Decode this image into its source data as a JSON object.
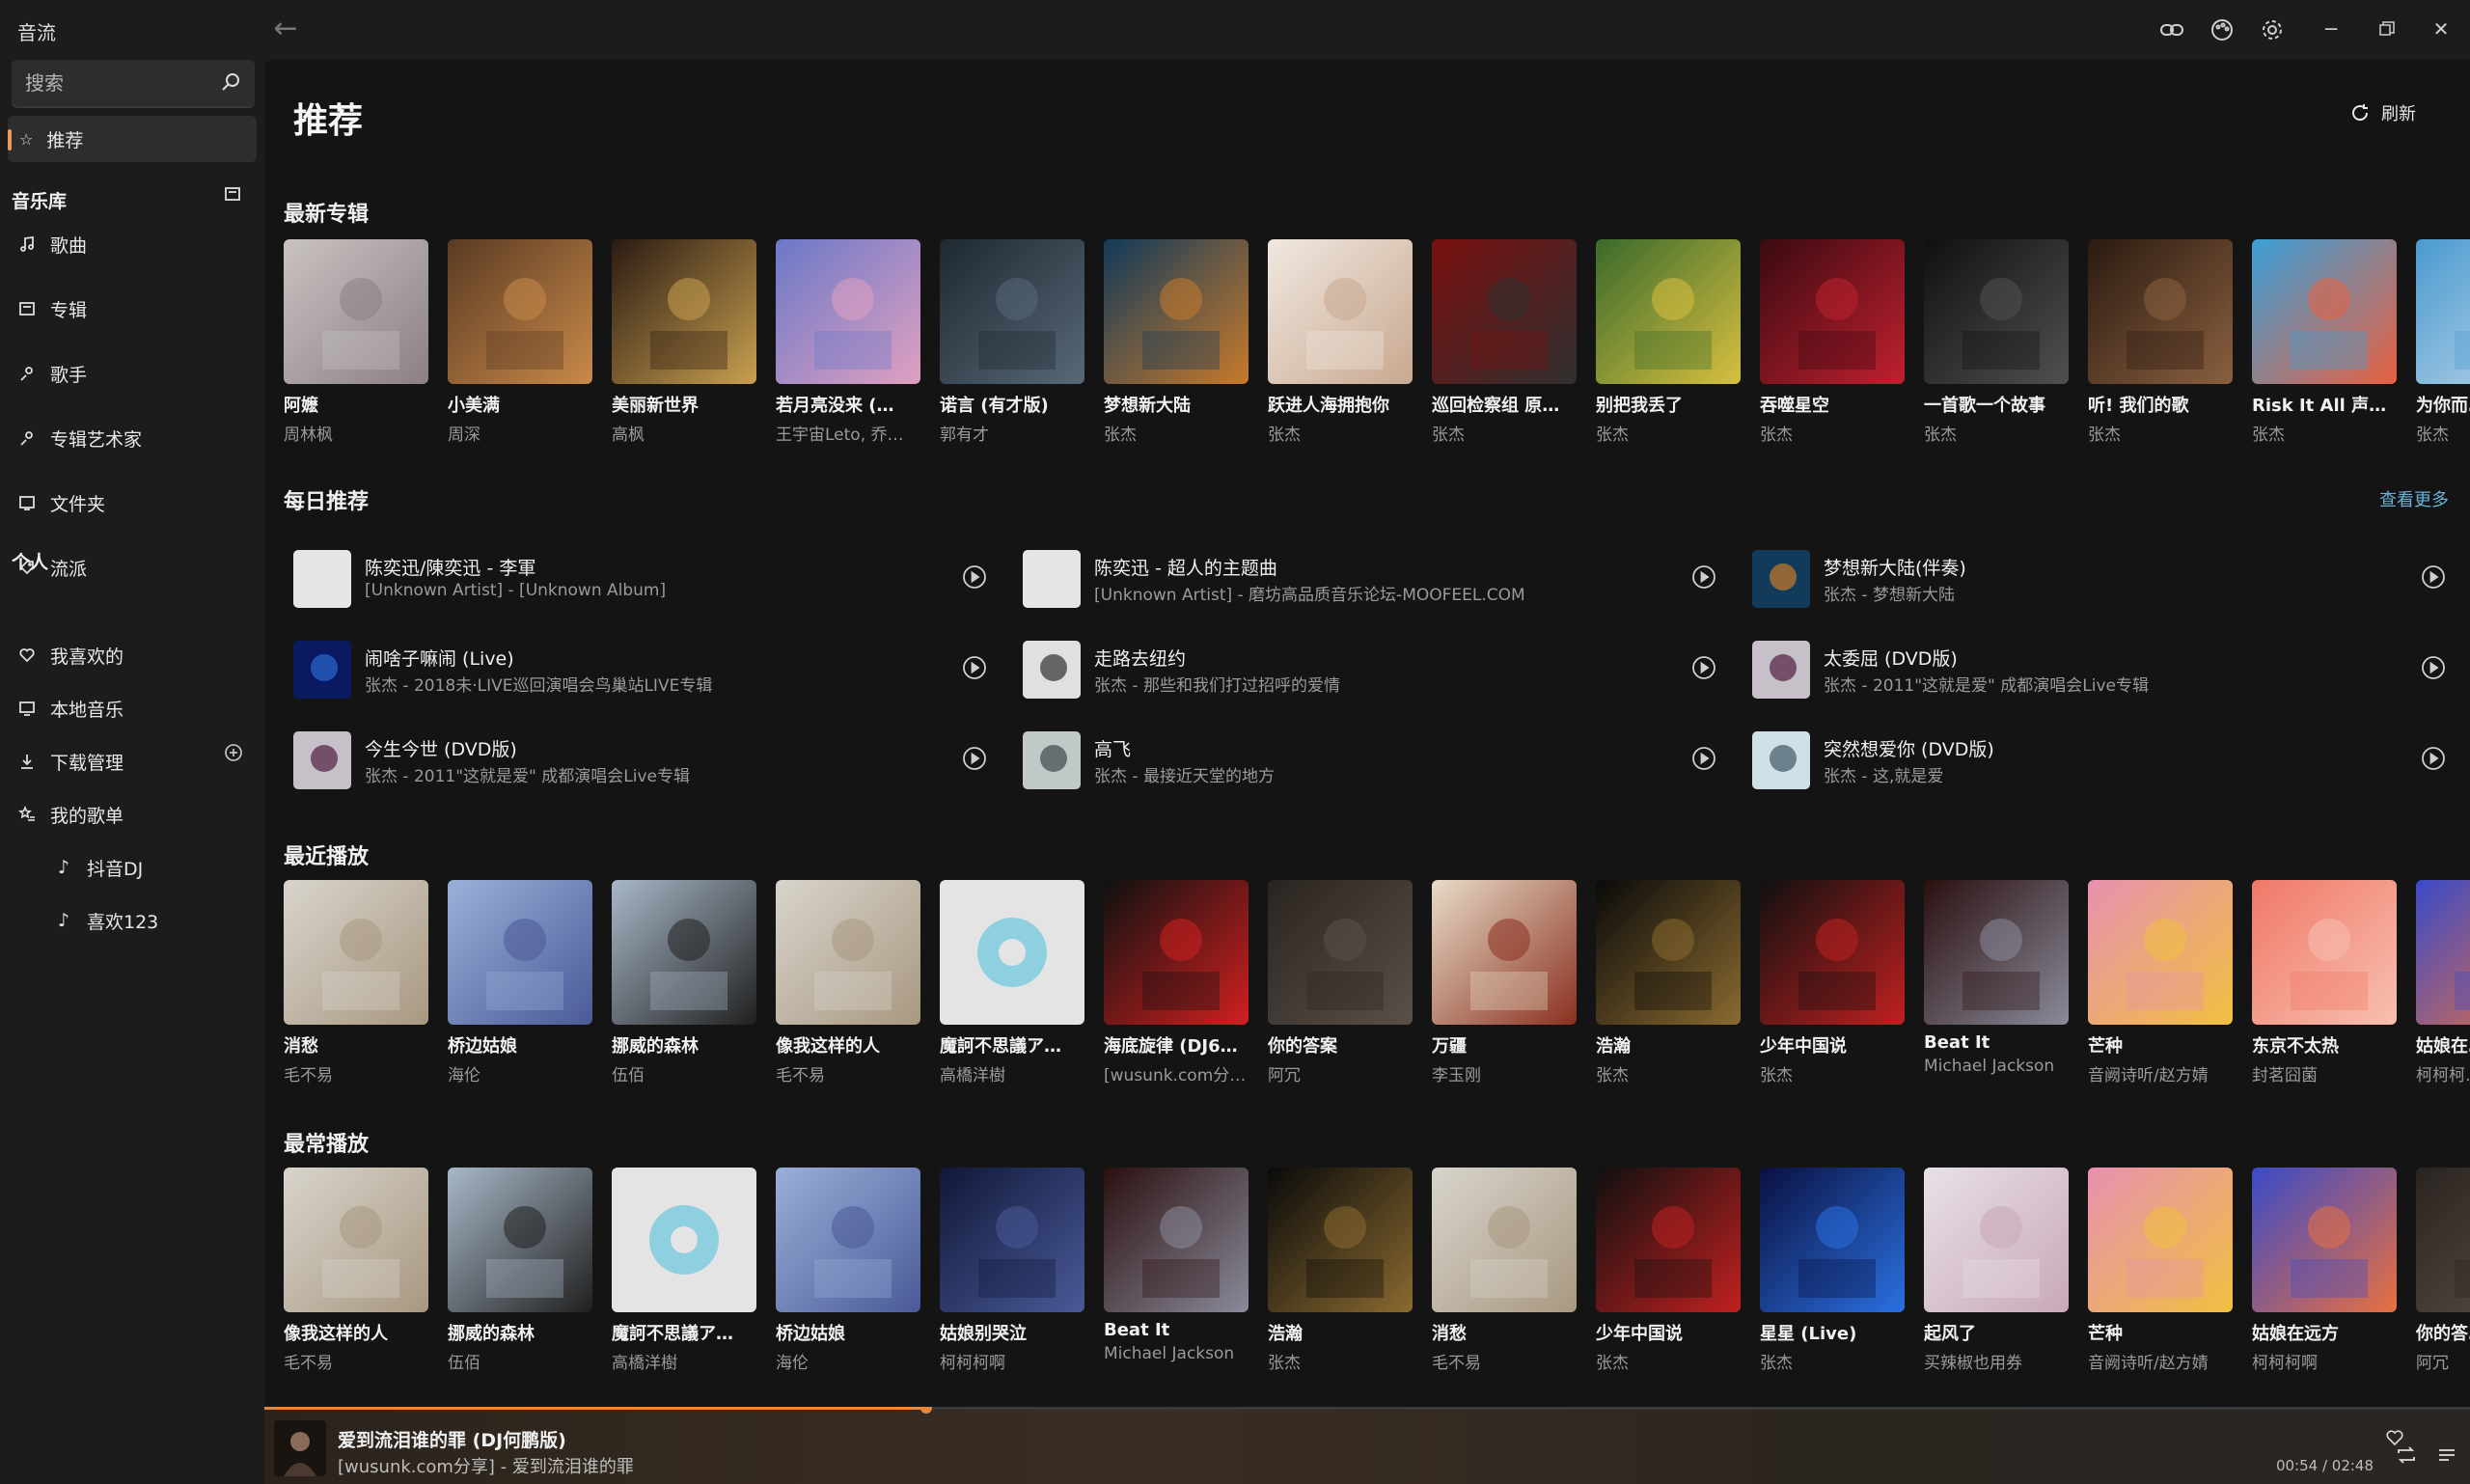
{
  "app": {
    "title": "音流"
  },
  "search": {
    "placeholder": "搜索"
  },
  "sidebar": {
    "recommend": "推荐",
    "library_header": "音乐库",
    "library": [
      {
        "label": "歌曲",
        "icon": "music-note-icon"
      },
      {
        "label": "专辑",
        "icon": "album-icon"
      },
      {
        "label": "歌手",
        "icon": "artist-icon"
      },
      {
        "label": "专辑艺术家",
        "icon": "album-artist-icon"
      },
      {
        "label": "文件夹",
        "icon": "folder-icon"
      },
      {
        "label": "流派",
        "icon": "genre-tag-icon"
      }
    ],
    "personal_header": "个人",
    "personal": [
      {
        "label": "我喜欢的",
        "icon": "heart-icon"
      },
      {
        "label": "本地音乐",
        "icon": "monitor-icon"
      },
      {
        "label": "下载管理",
        "icon": "download-icon"
      },
      {
        "label": "我的歌单",
        "icon": "playlist-star-icon"
      }
    ],
    "playlists": [
      {
        "label": "抖音DJ"
      },
      {
        "label": "喜欢123"
      }
    ]
  },
  "main": {
    "title": "推荐",
    "refresh_label": "刷新",
    "new_albums_title": "最新专辑",
    "daily_title": "每日推荐",
    "see_more": "查看更多",
    "recent_title": "最近播放",
    "frequent_title": "最常播放",
    "new_albums": [
      {
        "title": "阿嬷",
        "artist": "周林枫",
        "c1": "#c9c3c0",
        "c2": "#8a7f86"
      },
      {
        "title": "小美满",
        "artist": "周深",
        "c1": "#5a3a22",
        "c2": "#c98a4a"
      },
      {
        "title": "美丽新世界",
        "artist": "高枫",
        "c1": "#2a1a12",
        "c2": "#c8a050"
      },
      {
        "title": "若月亮没来 (…",
        "artist": "王宇宙Leto, 乔…",
        "c1": "#6a78c8",
        "c2": "#e0a0c0"
      },
      {
        "title": "诺言 (有才版)",
        "artist": "郭有才",
        "c1": "#1e2830",
        "c2": "#586878"
      },
      {
        "title": "梦想新大陆",
        "artist": "张杰",
        "c1": "#123a5a",
        "c2": "#c87a2a"
      },
      {
        "title": "跃进人海拥抱你",
        "artist": "张杰",
        "c1": "#f0e8e0",
        "c2": "#c8a890"
      },
      {
        "title": "巡回检察组 原…",
        "artist": "张杰",
        "c1": "#7a1010",
        "c2": "#303030"
      },
      {
        "title": "别把我丢了",
        "artist": "张杰",
        "c1": "#3a6a2a",
        "c2": "#d8c040"
      },
      {
        "title": "吞噬星空",
        "artist": "张杰",
        "c1": "#3a0a10",
        "c2": "#c02030"
      },
      {
        "title": "一首歌一个故事",
        "artist": "张杰",
        "c1": "#101010",
        "c2": "#505050"
      },
      {
        "title": "听! 我们的歌",
        "artist": "张杰",
        "c1": "#2a1a10",
        "c2": "#8a6040"
      },
      {
        "title": "Risk It All 声来…",
        "artist": "张杰",
        "c1": "#3aa0d8",
        "c2": "#e86040"
      },
      {
        "title": "为你而…",
        "artist": "张杰",
        "c1": "#4a9ad0",
        "c2": "#c0d8e8"
      }
    ],
    "daily": [
      {
        "title": "陈奕迅/陳奕迅 - 李軍",
        "sub": "[Unknown Artist] - [Unknown Album]",
        "c1": "#e6e6e6",
        "c2": "#e6e6e6"
      },
      {
        "title": "陈奕迅 - 超人的主题曲",
        "sub": "[Unknown Artist] - 磨坊高品质音乐论坛-MOOFEEL.COM",
        "c1": "#e6e6e6",
        "c2": "#e6e6e6"
      },
      {
        "title": "梦想新大陆(伴奏)",
        "sub": "张杰 - 梦想新大陆",
        "c1": "#123a5a",
        "c2": "#c87a2a"
      },
      {
        "title": "闹啥子嘛闹 (Live)",
        "sub": "张杰 - 2018未·LIVE巡回演唱会鸟巢站LIVE专辑",
        "c1": "#0a1a60",
        "c2": "#2a6ad0"
      },
      {
        "title": "走路去纽约",
        "sub": "张杰 - 那些和我们打过招呼的爱情",
        "c1": "#e0e0e0",
        "c2": "#303030"
      },
      {
        "title": "太委屈 (DVD版)",
        "sub": "张杰 - 2011\"这就是爱\" 成都演唱会Live专辑",
        "c1": "#c8c0c8",
        "c2": "#502040"
      },
      {
        "title": "今生今世 (DVD版)",
        "sub": "张杰 - 2011\"这就是爱\" 成都演唱会Live专辑",
        "c1": "#c8c0c8",
        "c2": "#502040"
      },
      {
        "title": "高飞",
        "sub": "张杰 - 最接近天堂的地方",
        "c1": "#c0c8c8",
        "c2": "#404848"
      },
      {
        "title": "突然想爱你 (DVD版)",
        "sub": "张杰 - 这,就是爱",
        "c1": "#d0e0e8",
        "c2": "#405868"
      }
    ],
    "recent": [
      {
        "title": "消愁",
        "artist": "毛不易",
        "c1": "#d8d4cc",
        "c2": "#a89880"
      },
      {
        "title": "桥边姑娘",
        "artist": "海伦",
        "c1": "#9ab0d8",
        "c2": "#4a5a98"
      },
      {
        "title": "挪威的森林",
        "artist": "伍佰",
        "c1": "#a8b8c8",
        "c2": "#202020"
      },
      {
        "title": "像我这样的人",
        "artist": "毛不易",
        "c1": "#d8d4cc",
        "c2": "#a89880"
      },
      {
        "title": "魔訶不思議ア…",
        "artist": "高橋洋樹",
        "c1": "#e0e0e0",
        "c2": "#e0e0e0",
        "disc": true
      },
      {
        "title": "海底旋律 (DJ6…",
        "artist": "[wusunk.com分…",
        "c1": "#101010",
        "c2": "#d02020"
      },
      {
        "title": "你的答案",
        "artist": "阿冗",
        "c1": "#2a2420",
        "c2": "#5a5048"
      },
      {
        "title": "万疆",
        "artist": "李玉刚",
        "c1": "#e8dcc8",
        "c2": "#8a3020"
      },
      {
        "title": "浩瀚",
        "artist": "张杰",
        "c1": "#0a0a0a",
        "c2": "#8a6a30"
      },
      {
        "title": "少年中国说",
        "artist": "张杰",
        "c1": "#101010",
        "c2": "#c02020"
      },
      {
        "title": "Beat It",
        "artist": "Michael Jackson",
        "c1": "#2a1010",
        "c2": "#8a8a9a"
      },
      {
        "title": "芒种",
        "artist": "音阙诗听/赵方婧",
        "c1": "#e890b0",
        "c2": "#f0c040"
      },
      {
        "title": "东京不太热",
        "artist": "封茗囧菌",
        "c1": "#f07868",
        "c2": "#f8c0b0"
      },
      {
        "title": "姑娘在…",
        "artist": "柯柯柯…",
        "c1": "#3a4ac8",
        "c2": "#e87040"
      }
    ],
    "frequent": [
      {
        "title": "像我这样的人",
        "artist": "毛不易",
        "c1": "#d8d4cc",
        "c2": "#a89880"
      },
      {
        "title": "挪威的森林",
        "artist": "伍佰",
        "c1": "#a8b8c8",
        "c2": "#202020"
      },
      {
        "title": "魔訶不思議ア…",
        "artist": "高橋洋樹",
        "c1": "#e0e0e0",
        "c2": "#e0e0e0",
        "disc": true
      },
      {
        "title": "桥边姑娘",
        "artist": "海伦",
        "c1": "#9ab0d8",
        "c2": "#4a5a98"
      },
      {
        "title": "姑娘别哭泣",
        "artist": "柯柯柯啊",
        "c1": "#101838",
        "c2": "#4a5a98"
      },
      {
        "title": "Beat It",
        "artist": "Michael Jackson",
        "c1": "#2a1010",
        "c2": "#8a8a9a"
      },
      {
        "title": "浩瀚",
        "artist": "张杰",
        "c1": "#0a0a0a",
        "c2": "#8a6a30"
      },
      {
        "title": "消愁",
        "artist": "毛不易",
        "c1": "#d8d4cc",
        "c2": "#a89880"
      },
      {
        "title": "少年中国说",
        "artist": "张杰",
        "c1": "#101010",
        "c2": "#c02020"
      },
      {
        "title": "星星 (Live)",
        "artist": "张杰",
        "c1": "#0a1040",
        "c2": "#2a70e0"
      },
      {
        "title": "起风了",
        "artist": "买辣椒也用券",
        "c1": "#e8e0e8",
        "c2": "#c8a8b8"
      },
      {
        "title": "芒种",
        "artist": "音阙诗听/赵方婧",
        "c1": "#e890b0",
        "c2": "#f0c040"
      },
      {
        "title": "姑娘在远方",
        "artist": "柯柯柯啊",
        "c1": "#3a4ac8",
        "c2": "#e87040"
      },
      {
        "title": "你的答…",
        "artist": "阿冗",
        "c1": "#2a2420",
        "c2": "#5a5048"
      }
    ]
  },
  "player": {
    "title": "爱到流泪谁的罪 (DJ何鹏版)",
    "subtitle": "[wusunk.com分享] - 爱到流泪谁的罪",
    "time": "00:54 / 02:48",
    "progress": 0.3,
    "accent": "#e8873a"
  },
  "colors": {
    "accent": "#e89a5a",
    "link": "#6ab0d8"
  }
}
